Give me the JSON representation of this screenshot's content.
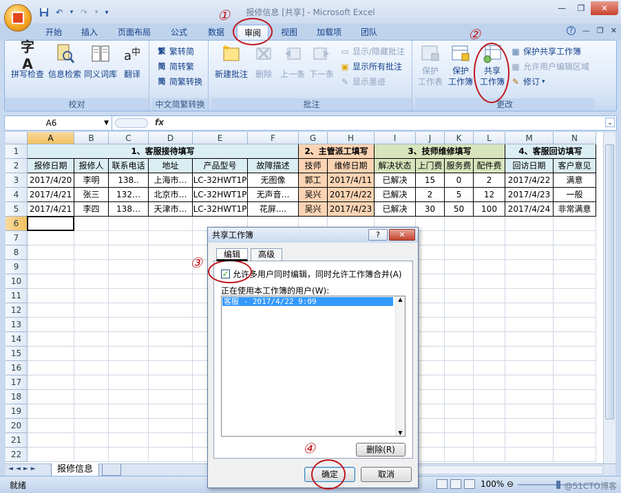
{
  "app": {
    "title": "报修信息 [共享] - Microsoft Excel"
  },
  "window_controls": {
    "minimize": "—",
    "restore": "❐",
    "close": "✕"
  },
  "quick_access": {
    "save_icon": "save-icon",
    "undo_icon": "undo-icon",
    "redo_icon": "redo-icon",
    "customize_icon": "▾"
  },
  "ribbon_tabs": [
    "开始",
    "插入",
    "页面布局",
    "公式",
    "数据",
    "审阅",
    "视图",
    "加载项",
    "团队"
  ],
  "active_tab": "审阅",
  "help": {
    "help": "?",
    "min": "—",
    "restore": "❐",
    "close": "✕"
  },
  "ribbon": {
    "proofing": {
      "label": "校对",
      "buttons": [
        "拼写检查",
        "信息检索",
        "同义词库",
        "翻译"
      ]
    },
    "chinese": {
      "label": "中文简繁转换",
      "buttons": [
        "繁转简",
        "简转繁",
        "简繁转换"
      ]
    },
    "comments": {
      "label": "批注",
      "new": "新建批注",
      "delete": "删除",
      "prev": "上一条",
      "next": "下一条",
      "show_hide": "显示/隐藏批注",
      "show_all": "显示所有批注",
      "show_ink": "显示墨迹"
    },
    "changes": {
      "label": "更改",
      "protect_sheet": [
        "保护",
        "工作表"
      ],
      "protect_book": [
        "保护",
        "工作簿"
      ],
      "share_book": [
        "共享",
        "工作簿"
      ],
      "protect_share": "保护共享工作簿",
      "allow_users": "允许用户编辑区域",
      "track": "修订"
    }
  },
  "formula_bar": {
    "name_box": "A6",
    "fx": "fx",
    "value": ""
  },
  "columns": [
    "A",
    "B",
    "C",
    "D",
    "E",
    "F",
    "G",
    "H",
    "I",
    "J",
    "K",
    "L",
    "M",
    "N"
  ],
  "rows": [
    "1",
    "2",
    "3",
    "4",
    "5",
    "6",
    "7",
    "8",
    "9",
    "10",
    "11",
    "12",
    "13",
    "14",
    "15",
    "16",
    "17",
    "18",
    "19",
    "20",
    "21",
    "22"
  ],
  "sheet": {
    "row1": [
      "1、客服接待填写",
      "2、主管派工填写",
      "3、技师维修填写",
      "4、客服回访填写"
    ],
    "row2": [
      "报修日期",
      "报修人",
      "联系电话",
      "地址",
      "产品型号",
      "故障描述",
      "技师",
      "维修日期",
      "解决状态",
      "上门费",
      "服务费",
      "配件费",
      "回访日期",
      "客户意见"
    ],
    "data": [
      [
        "2017/4/20",
        "李明",
        "138..",
        "上海市…",
        "LC-32HWT1P",
        "无图像",
        "郭工",
        "2017/4/11",
        "已解决",
        "15",
        "0",
        "2",
        "2017/4/22",
        "满意"
      ],
      [
        "2017/4/21",
        "张三",
        "132…",
        "北京市…",
        "LC-32HWT1P",
        "无声音…",
        "吴兴",
        "2017/4/22",
        "已解决",
        "2",
        "5",
        "12",
        "2017/4/23",
        "一般"
      ],
      [
        "2017/4/21",
        "李四",
        "138…",
        "天津市…",
        "LC-32HWT1P",
        "花屏....",
        "吴兴",
        "2017/4/23",
        "已解决",
        "30",
        "50",
        "100",
        "2017/4/24",
        "非常满意"
      ]
    ]
  },
  "sheet_tabs": [
    "报修信息"
  ],
  "status": {
    "ready": "就绪",
    "zoom": "100%",
    "minus": "⊖",
    "plus": "⊕"
  },
  "watermark": "@51CTO博客",
  "dialog": {
    "title": "共享工作簿",
    "help": "?",
    "close": "✕",
    "tabs": [
      "编辑",
      "高级"
    ],
    "checkbox_label": "允许多用户同时编辑，同时允许工作簿合并(A)",
    "checked": true,
    "users_label": "正在使用本工作簿的用户(W):",
    "users": [
      "客服 - 2017/4/22 9:09"
    ],
    "remove": "删除(R)",
    "ok": "确定",
    "cancel": "取消"
  },
  "annotations": [
    "①",
    "②",
    "③",
    "④"
  ],
  "colors": {
    "accent": "#c0141b",
    "header1": "#dbeef4",
    "header2": "#fbd4b4",
    "header3": "#d7e4bc",
    "header4": "#dbeef4",
    "selection": "#3399ff"
  }
}
